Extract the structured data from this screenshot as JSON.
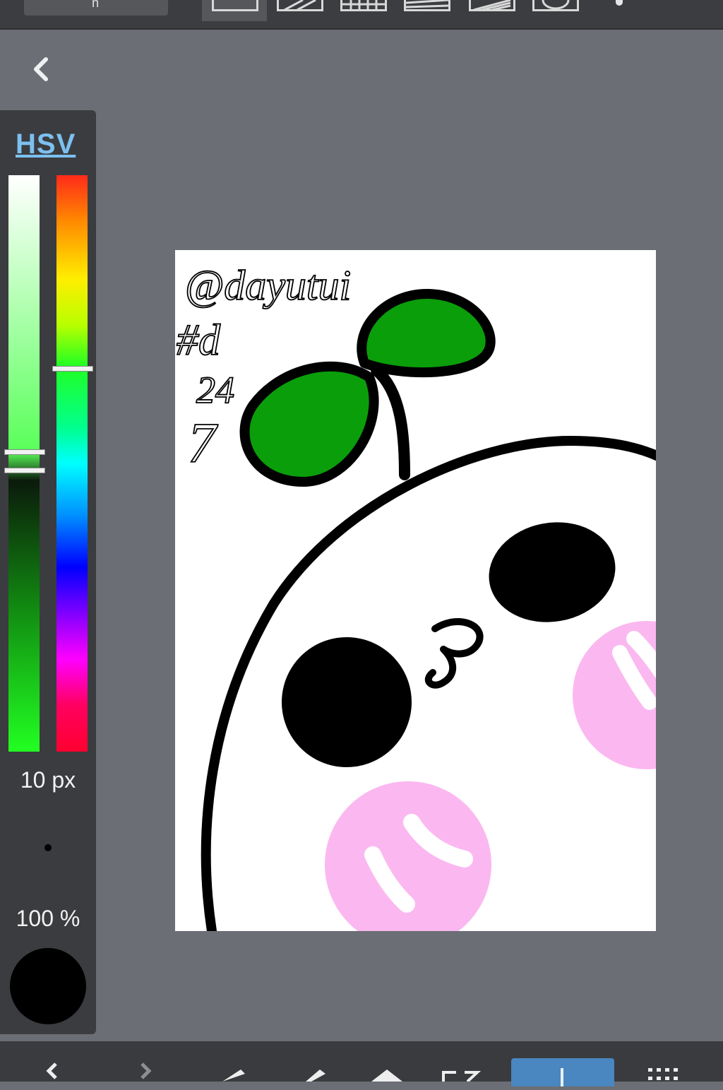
{
  "top_toolbar": {
    "layer_button_glyph": "ñ",
    "snap_modes": [
      "snap-off",
      "parallel-lines",
      "grid",
      "perspective",
      "radial",
      "circle"
    ],
    "more_icon": "more-dots-icon"
  },
  "navigation": {
    "back_icon": "chevron-left-icon"
  },
  "color_panel": {
    "tab_label": "HSV",
    "brush_size": "10 px",
    "opacity": "100 %",
    "current_color": "#000000",
    "hue": 0.34,
    "saturation_value_position": 0.49
  },
  "canvas": {
    "signature_lines": [
      "@dayutui",
      "#d",
      "24",
      "7"
    ],
    "colors": {
      "leaf": "#0a9e0a",
      "blush": "#fbb8f0",
      "outline": "#000000",
      "paper": "#ffffff"
    }
  },
  "bottom_toolbar": {
    "items": [
      "undo-icon",
      "redo-icon",
      "eyedropper-icon",
      "pen-icon",
      "eraser-icon",
      "transform-icon",
      "brush-tool-icon",
      "grid-menu-icon"
    ],
    "active_item": "brush-tool-icon"
  },
  "colors": {
    "app_bg": "#6b6e74",
    "panel_bg": "#3b3c3f",
    "accent": "#7cc0f0",
    "active_tool": "#4a86c0"
  }
}
